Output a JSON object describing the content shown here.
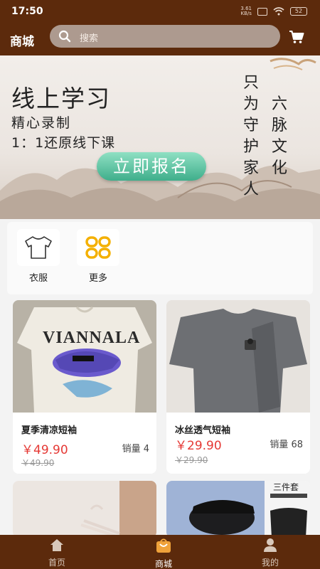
{
  "status_bar": {
    "time": "17:50",
    "net_speed": "3.61",
    "net_unit": "KB/s",
    "battery": "52"
  },
  "header": {
    "title": "商城",
    "search_placeholder": "搜索",
    "cart_icon": "cart-icon"
  },
  "banner": {
    "headline": "线上学习",
    "line1": "精心录制",
    "line2": "1：1还原线下课",
    "cta": "立即报名",
    "vertical_left": "只为守护家人",
    "vertical_right": "六脉文化"
  },
  "categories": [
    {
      "label": "衣服",
      "icon": "tshirt-icon"
    },
    {
      "label": "更多",
      "icon": "grid-icon"
    }
  ],
  "products": [
    {
      "name": "夏季清凉短袖",
      "price": "￥49.90",
      "sales": "销量 4",
      "original_price": "￥49.90",
      "image_text": "VIANNALA"
    },
    {
      "name": "冰丝透气短袖",
      "price": "￥29.90",
      "sales": "销量 68",
      "original_price": "￥29.90"
    },
    {
      "name": "",
      "price": "",
      "sales": "",
      "original_price": ""
    },
    {
      "name": "",
      "price": "",
      "sales": "",
      "original_price": "",
      "image_text": "三件套"
    }
  ],
  "tabbar": [
    {
      "label": "首页",
      "icon": "home-icon",
      "active": false
    },
    {
      "label": "商城",
      "icon": "shop-bag-icon",
      "active": true
    },
    {
      "label": "我的",
      "icon": "user-icon",
      "active": false
    }
  ],
  "colors": {
    "brand": "#5c2a0c",
    "price": "#e53935",
    "cta": "#3fae8b"
  }
}
